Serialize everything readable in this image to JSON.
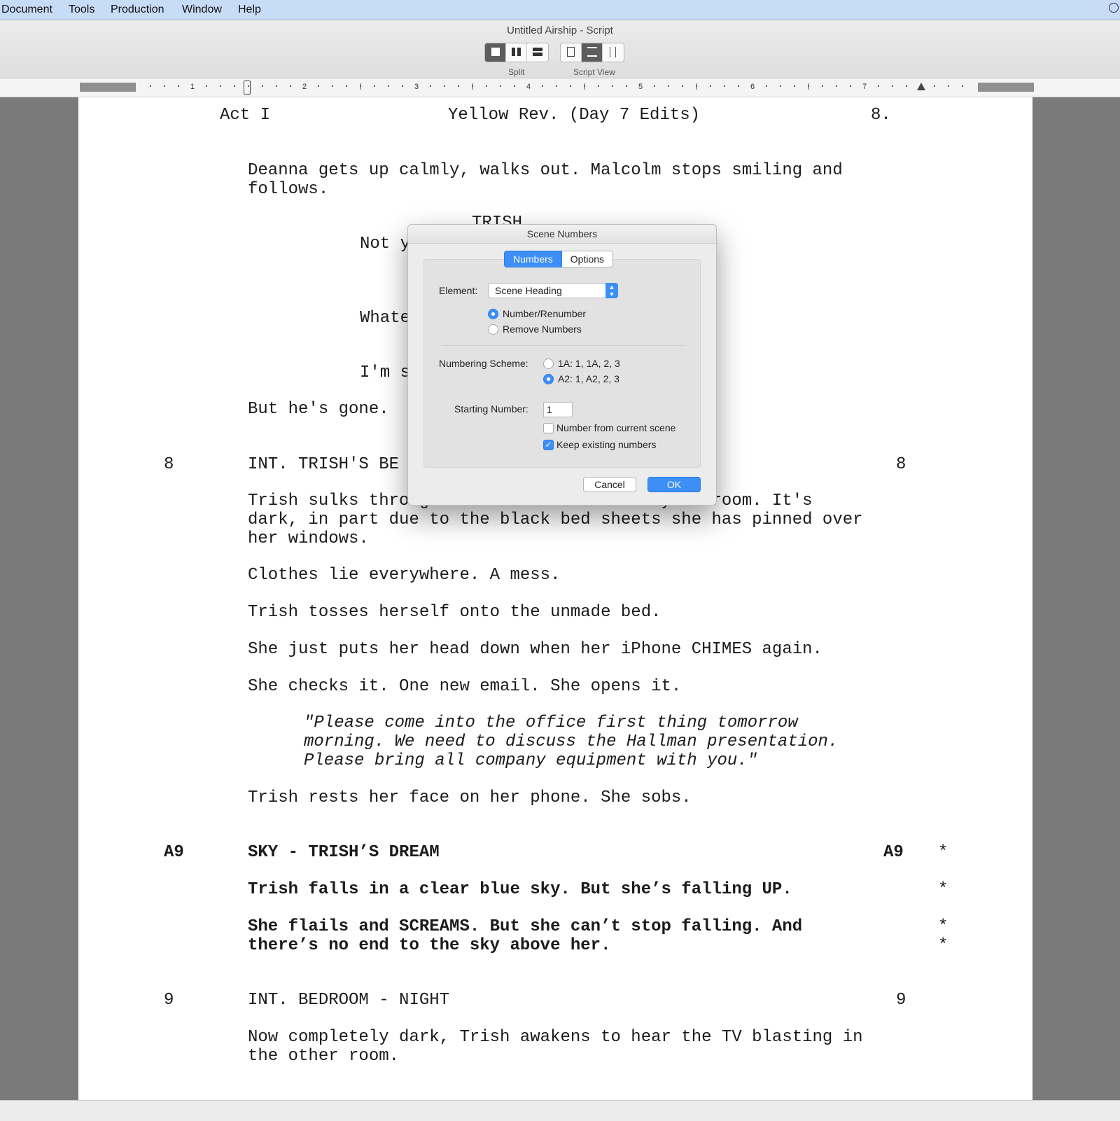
{
  "menu": [
    "Document",
    "Tools",
    "Production",
    "Window",
    "Help"
  ],
  "window_title": "Untitled Airship - Script",
  "toolbar": {
    "split_label": "Split",
    "script_view_label": "Script View"
  },
  "ruler": {
    "numbers": [
      "1",
      "2",
      "3",
      "4",
      "5",
      "6",
      "7"
    ]
  },
  "script": {
    "header_left": "Act I",
    "header_center": "Yellow Rev. (Day 7 Edits)",
    "page_number": "8.",
    "action_1a": "Deanna gets up calmly, walks out. Malcolm stops smiling and",
    "action_1b": "follows.",
    "char_partial": "TRISH",
    "dialog_partial_1": "Not y",
    "dialog_partial_2": "Whate",
    "dialog_partial_3": "I'm s",
    "action_2": "But he's gone.",
    "scene8_num": "8",
    "scene8_heading": "INT. TRISH'S BE",
    "scene8_num_right": "8",
    "action_3a": "Trish sulks through the door of her dreary bedroom. It's",
    "action_3b": "dark, in part due to the black bed sheets she has pinned over",
    "action_3c": "her windows.",
    "action_4": "Clothes lie everywhere. A mess.",
    "action_5": "Trish tosses herself onto the unmade bed.",
    "action_6": "She just puts her head down when her iPhone CHIMES again.",
    "action_7": "She checks it. One new email. She opens it.",
    "email_1": "\"Please come into the office first thing tomorrow",
    "email_2": "morning. We need to discuss the Hallman presentation.",
    "email_3": "Please bring all company equipment with you.\"",
    "action_8": "Trish rests her face on her phone. She sobs.",
    "sceneA9_num": "A9",
    "sceneA9_heading": "SKY - TRISH’S DREAM",
    "sceneA9_num_right": "A9",
    "revision_mark": "*",
    "action_9": "Trish falls in a clear blue sky. But she’s falling UP.",
    "action_10a": "She flails and SCREAMS. But she can’t stop falling. And",
    "action_10b": "there’s no end to the sky above her.",
    "scene9_num": "9",
    "scene9_heading": "INT. BEDROOM - NIGHT",
    "scene9_num_right": "9",
    "action_11a": "Now completely dark, Trish awakens to hear the TV blasting in",
    "action_11b": "the other room."
  },
  "dialog": {
    "title": "Scene Numbers",
    "tabs": [
      "Numbers",
      "Options"
    ],
    "active_tab": "Numbers",
    "element_label": "Element:",
    "element_value": "Scene Heading",
    "radio_number_renumber": "Number/Renumber",
    "radio_remove_numbers": "Remove Numbers",
    "selected_action": "Number/Renumber",
    "scheme_label": "Numbering Scheme:",
    "scheme_option_1": "1A: 1, 1A, 2, 3",
    "scheme_option_2": "A2: 1, A2, 2, 3",
    "selected_scheme": "A2: 1, A2, 2, 3",
    "starting_label": "Starting Number:",
    "starting_value": "1",
    "check_from_current": "Number from current scene",
    "check_from_current_checked": false,
    "check_keep_existing": "Keep existing numbers",
    "check_keep_existing_checked": true,
    "cancel_label": "Cancel",
    "ok_label": "OK"
  },
  "colors": {
    "accent": "#3d8ef5",
    "menubar": "#c7dcf6",
    "desk": "#7a7a7a"
  }
}
